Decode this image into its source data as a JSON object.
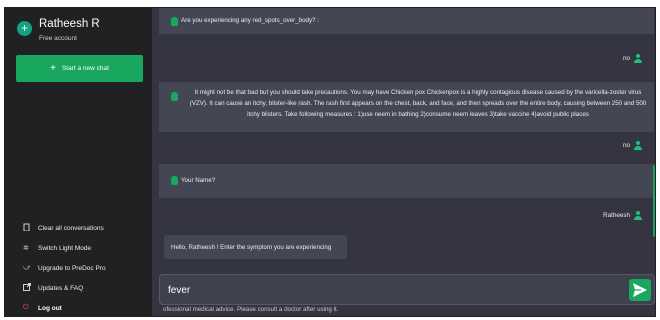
{
  "sidebar": {
    "user_name": "Ratheesh R",
    "plan": "Free account",
    "new_chat_label": "Start a new chat",
    "menu": [
      {
        "label": "Clear all conversations",
        "icon": "trash-icon"
      },
      {
        "label": "Switch Light Mode",
        "icon": "sun-icon"
      },
      {
        "label": "Upgrade to PreDoc Pro",
        "icon": "upgrade-icon"
      },
      {
        "label": "Updates & FAQ",
        "icon": "external-link-icon"
      },
      {
        "label": "Log out",
        "icon": "power-icon"
      }
    ]
  },
  "chat": {
    "messages": [
      {
        "role": "bot",
        "text": "Are you experiencing any red_spots_over_body? :"
      },
      {
        "role": "user",
        "text": "no"
      },
      {
        "role": "bot",
        "text": "It might not be that bad but you should take precautions. You may have Chicken pox Chickenpox is a highly contagious disease caused by the varicella-zoster virus (VZV). It can cause an itchy, blister-like rash. The rash first appears on the chest, back, and face, and then spreads over the entire body, causing between 250 and 500 itchy blisters. Take following measures : 1)use neem in bathing 2)consume neem leaves 3)take vaccine 4)avoid public places"
      },
      {
        "role": "user",
        "text": "no"
      },
      {
        "role": "bot",
        "text": "Your Name?"
      },
      {
        "role": "user",
        "text": "Ratheesh"
      },
      {
        "role": "bot",
        "text": "Hello, Ratheesh ! Enter the symptom you are experiencing"
      }
    ]
  },
  "input": {
    "value": "fever"
  },
  "disclaimer": "ofessional medical advice. Please consult a doctor after using it.",
  "colors": {
    "accent": "#19a65f",
    "sidebar_bg": "#202123",
    "main_bg": "#343541",
    "bot_bg": "#444654",
    "logout_icon": "#ff4a4a"
  }
}
